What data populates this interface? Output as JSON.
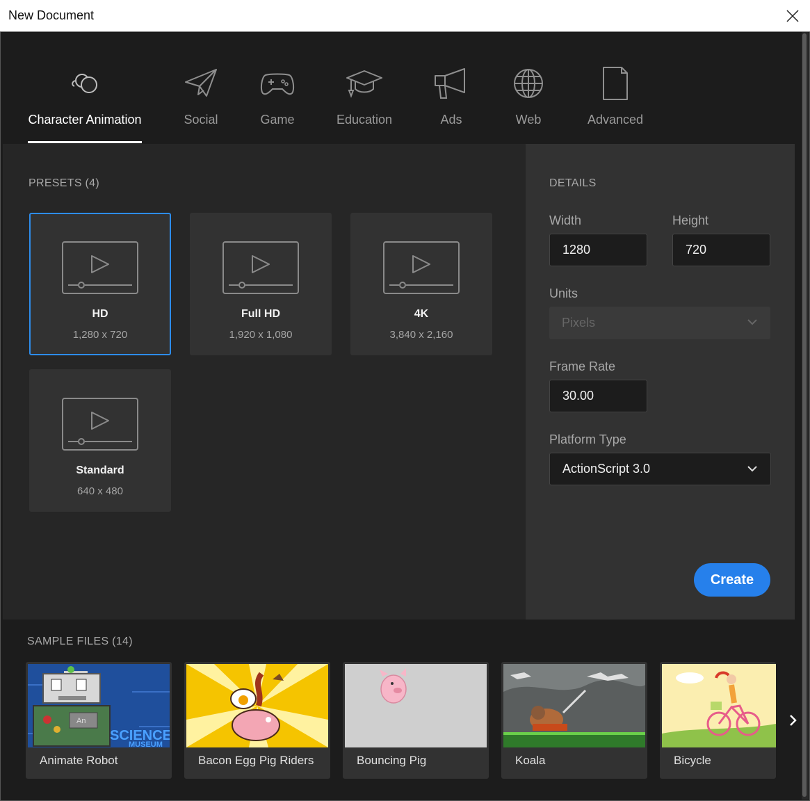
{
  "window": {
    "title": "New Document"
  },
  "tabs": [
    {
      "label": "Character Animation",
      "icon": "character-animation-icon",
      "active": true
    },
    {
      "label": "Social",
      "icon": "paper-plane-icon"
    },
    {
      "label": "Game",
      "icon": "gamepad-icon"
    },
    {
      "label": "Education",
      "icon": "graduation-cap-icon"
    },
    {
      "label": "Ads",
      "icon": "megaphone-icon"
    },
    {
      "label": "Web",
      "icon": "globe-icon"
    },
    {
      "label": "Advanced",
      "icon": "document-icon"
    }
  ],
  "presets": {
    "title": "PRESETS (4)",
    "items": [
      {
        "name": "HD",
        "size": "1,280 x 720",
        "selected": true
      },
      {
        "name": "Full HD",
        "size": "1,920 x 1,080"
      },
      {
        "name": "4K",
        "size": "3,840 x 2,160"
      },
      {
        "name": "Standard",
        "size": "640 x 480"
      }
    ]
  },
  "details": {
    "title": "DETAILS",
    "width_label": "Width",
    "width_value": "1280",
    "height_label": "Height",
    "height_value": "720",
    "units_label": "Units",
    "units_value": "Pixels",
    "frame_rate_label": "Frame Rate",
    "frame_rate_value": "30.00",
    "platform_label": "Platform Type",
    "platform_value": "ActionScript 3.0",
    "create_label": "Create"
  },
  "samples": {
    "title": "SAMPLE FILES (14)",
    "items": [
      {
        "name": "Animate Robot",
        "badge": "SCIENCE",
        "badge_sub": "MUSEUM",
        "screen_text": "An"
      },
      {
        "name": "Bacon Egg Pig Riders"
      },
      {
        "name": "Bouncing Pig"
      },
      {
        "name": "Koala"
      },
      {
        "name": "Bicycle"
      }
    ]
  },
  "colors": {
    "accent": "#2680eb",
    "selected_border": "#2d8ceb",
    "panel": "#262626",
    "details_panel": "#323232",
    "background": "#1c1c1c"
  }
}
